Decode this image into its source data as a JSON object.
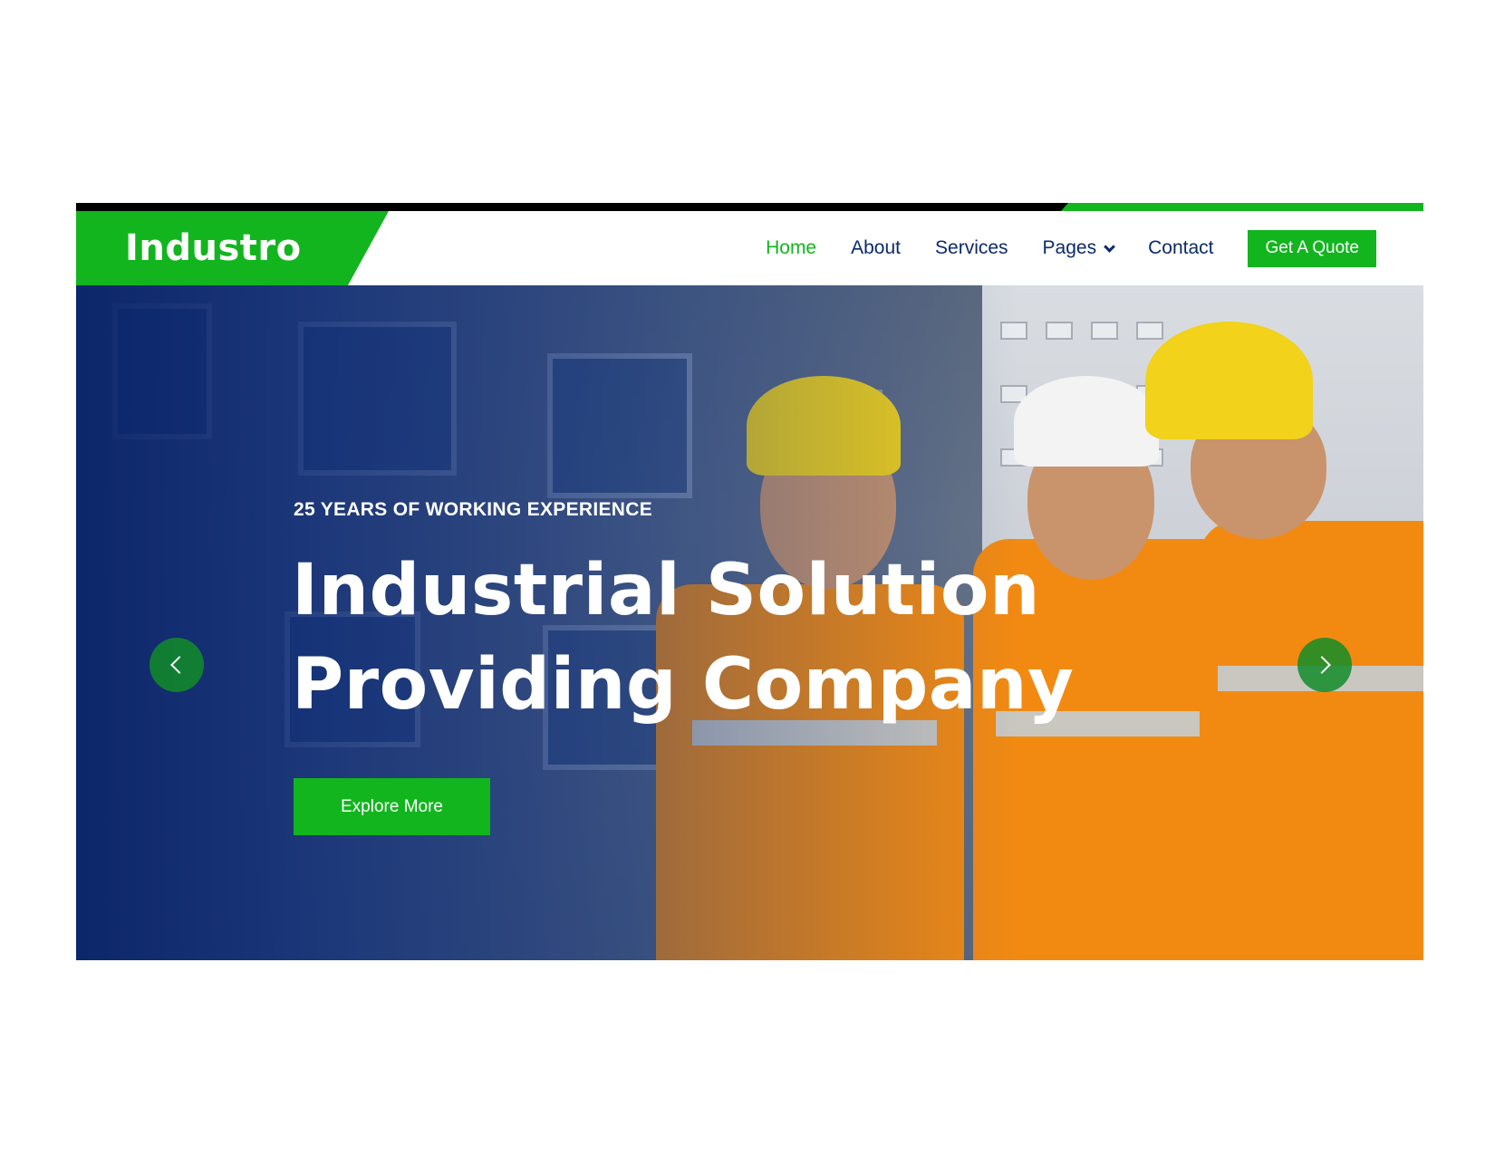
{
  "brand": {
    "name": "Industro"
  },
  "colors": {
    "accent": "#12b51e",
    "navy": "#0b2a6b"
  },
  "nav": {
    "items": [
      {
        "label": "Home",
        "active": true
      },
      {
        "label": "About"
      },
      {
        "label": "Services"
      },
      {
        "label": "Pages",
        "dropdown": true
      },
      {
        "label": "Contact"
      }
    ],
    "cta_label": "Get A Quote"
  },
  "hero": {
    "eyebrow": "25 YEARS OF WORKING EXPERIENCE",
    "headline_line1": "Industrial Solution",
    "headline_line2": "Providing Company",
    "button_label": "Explore More",
    "prev_icon": "chevron-left-icon",
    "next_icon": "chevron-right-icon"
  }
}
